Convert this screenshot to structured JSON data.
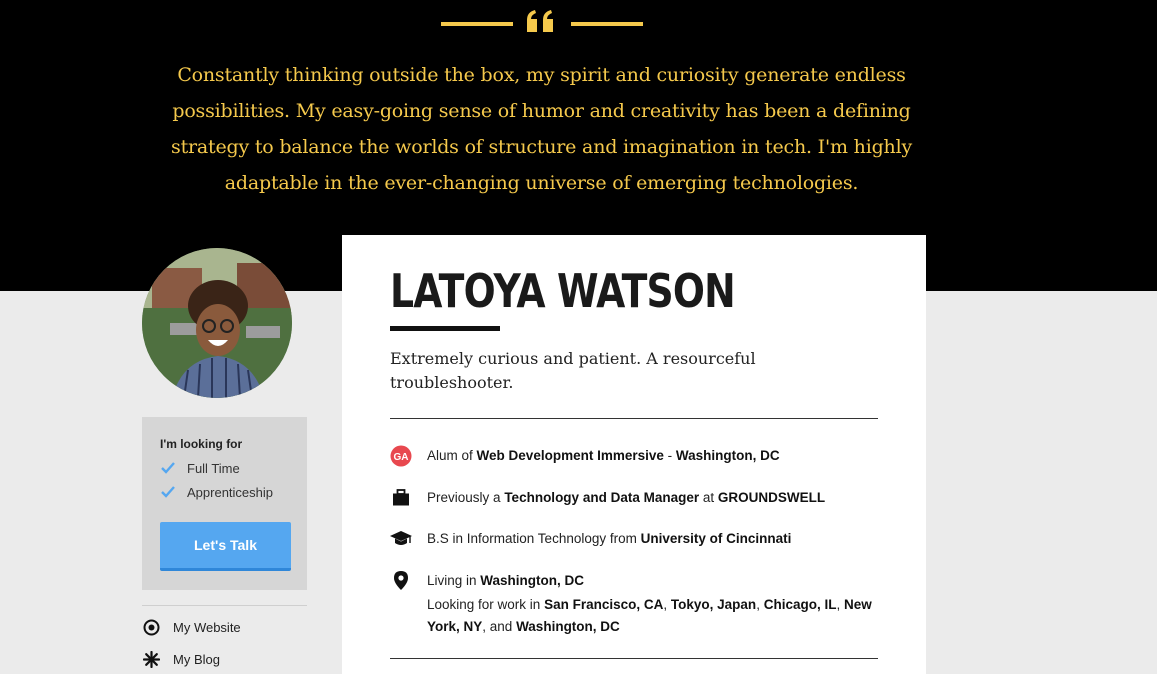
{
  "quote": {
    "text": "Constantly thinking outside the box, my spirit and curiosity generate endless possibilities. My easy-going sense of humor and creativity has been a defining strategy to balance the worlds of structure and imagination in tech. I'm highly adaptable in the ever-changing universe of emerging technologies."
  },
  "sidebar": {
    "looking_title": "I'm looking for",
    "looking_items": [
      "Full Time",
      "Apprenticeship"
    ],
    "talk_button": "Let's Talk",
    "links": [
      {
        "label": "My Website",
        "icon": "target-icon"
      },
      {
        "label": "My Blog",
        "icon": "asterisk-icon"
      }
    ]
  },
  "profile": {
    "name": "LATOYA WATSON",
    "tagline": "Extremely curious and patient. A resourceful troubleshooter.",
    "facts": {
      "alum": {
        "prefix": "Alum of",
        "program": "Web Development Immersive",
        "sep": "-",
        "location": "Washington, DC",
        "icon": "ga-logo-icon"
      },
      "previous": {
        "prefix": "Previously a",
        "role": "Technology and Data Manager",
        "at": "at",
        "company": "GROUNDSWELL",
        "icon": "briefcase-icon"
      },
      "education": {
        "prefix": "B.S in Information Technology from",
        "school": "University of Cincinnati",
        "icon": "graduation-cap-icon"
      },
      "location": {
        "living_prefix": "Living in",
        "living": "Washington, DC",
        "looking_prefix": "Looking for work in",
        "cities": [
          "San Francisco, CA",
          "Tokyo, Japan",
          "Chicago, IL",
          "New York, NY",
          "Washington, DC"
        ],
        "sep": ",",
        "and": ", and",
        "icon": "map-pin-icon"
      }
    }
  },
  "colors": {
    "accent_gold": "#f5c94c",
    "button_blue": "#55a7f0",
    "ga_red": "#e8484f"
  }
}
